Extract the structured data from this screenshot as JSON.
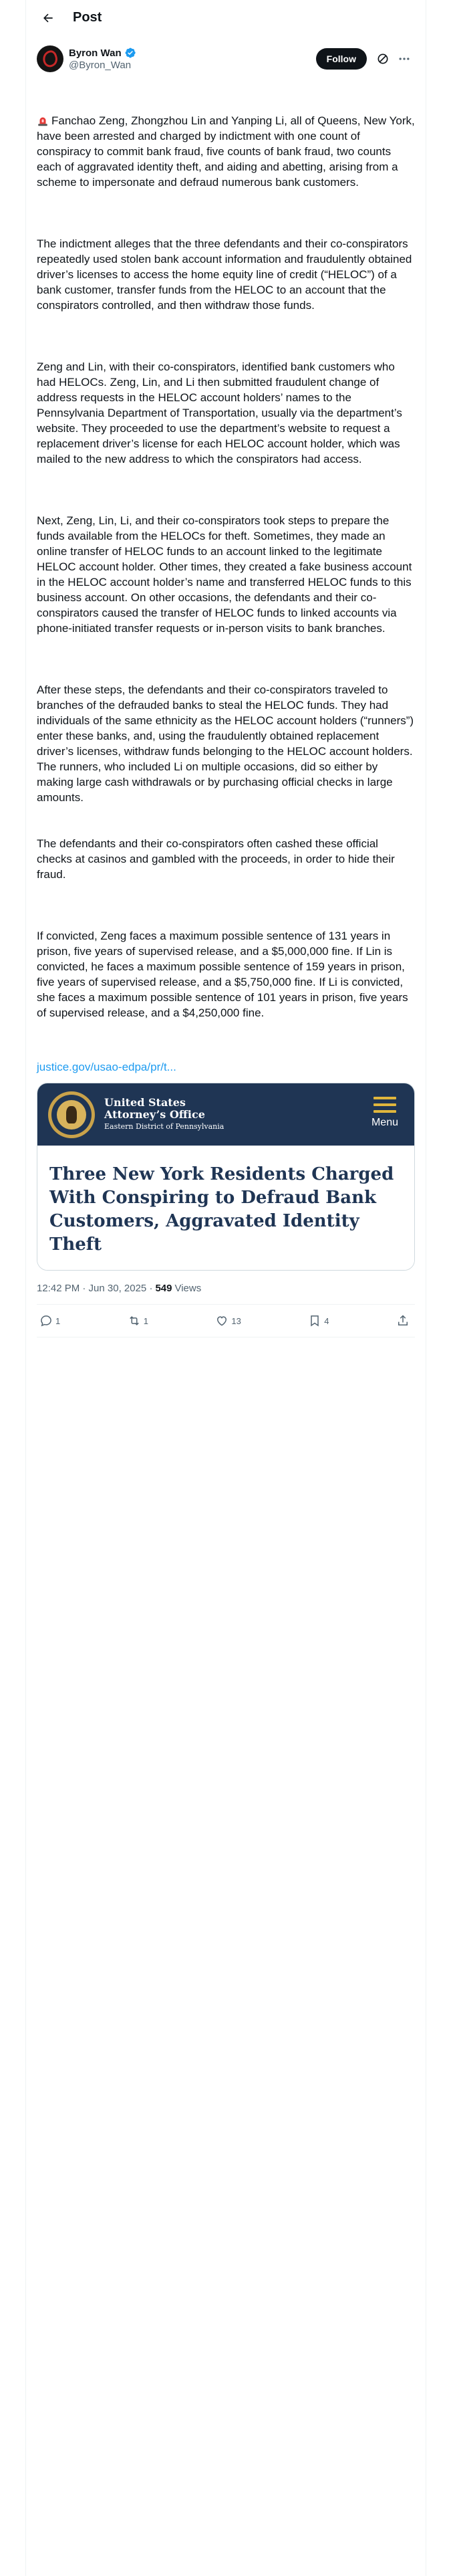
{
  "header": {
    "title": "Post"
  },
  "author": {
    "display_name": "Byron Wan",
    "handle": "@Byron_Wan",
    "verified": true
  },
  "follow_button": {
    "label": "Follow"
  },
  "tweet": {
    "paragraphs": [
      "Fanchao Zeng, Zhongzhou Lin and Yanping Li, all of Queens, New York, have been arrested and charged by indictment with one count of conspiracy to commit bank fraud, five counts of bank fraud, two counts each of aggravated identity theft, and aiding and abetting, arising from a scheme to impersonate and defraud numerous bank customers.",
      "The indictment alleges that the three defendants and their co-conspirators repeatedly used stolen bank account information and fraudulently obtained driver’s licenses to access the home equity line of credit (“HELOC”) of a bank customer, transfer funds from the HELOC to an account that the conspirators controlled, and then withdraw those funds.",
      "Zeng and Lin, with their co-conspirators, identified bank customers who had HELOCs. Zeng, Lin, and Li then submitted fraudulent change of address requests in the HELOC account holders’ names to the Pennsylvania Department of Transportation, usually via the department’s website. They proceeded to use the department’s website to request a replacement driver’s license for each HELOC account holder, which was mailed to the new address to which the conspirators had access.",
      "Next, Zeng, Lin, Li, and their co-conspirators took steps to prepare the funds available from the HELOCs for theft. Sometimes, they made an online transfer of HELOC funds to an account linked to the legitimate HELOC account holder. Other times, they created a fake business account in the HELOC account holder’s name and transferred HELOC funds to this business account. On other occasions, the defendants and their co-conspirators caused the transfer of HELOC funds to linked accounts via phone-initiated transfer requests or in-person visits to bank branches.",
      "After these steps, the defendants and their co-conspirators traveled to branches of the defrauded banks to steal the HELOC funds. They had individuals of the same ethnicity as the HELOC account holders (“runners”) enter these banks, and, using the fraudulently obtained replacement driver’s licenses, withdraw funds belonging to the HELOC account holders. The runners, who included Li on multiple occasions, did so either by making large cash withdrawals or by purchasing official checks in large amounts.",
      "The defendants and their co-conspirators often cashed these official checks at casinos and gambled with the proceeds, in order to hide their fraud.",
      "If convicted, Zeng faces a maximum possible sentence of 131 years in prison, five years of supervised release, and a $5,000,000 fine. If Lin is convicted, he faces a maximum possible sentence of 159 years in prison, five years of supervised release, and a $5,750,000 fine. If Li is convicted, she faces a maximum possible sentence of 101 years in prison, five years of supervised release, and a $4,250,000 fine."
    ],
    "link_text": "justice.gov/usao-edpa/pr/t..."
  },
  "card": {
    "office_line1": "United States",
    "office_line2": "Attorney’s Office",
    "office_line3": "Eastern District of Pennsylvania",
    "menu_label": "Menu",
    "headline": "Three New York Residents Charged With Conspiring to Defraud Bank Customers, Aggravated Identity Theft"
  },
  "meta": {
    "timestamp": "12:42 PM · Jun 30, 2025 · ",
    "views_count": "549",
    "views_label": "Views"
  },
  "actions": {
    "replies": "1",
    "reposts": "1",
    "likes": "13",
    "bookmarks": "4"
  },
  "colors": {
    "accent": "#1d9bf0",
    "text": "#0f1419",
    "muted": "#536471",
    "card_navy": "#1f3554",
    "card_gold": "#e0b63c"
  },
  "icons": [
    "back-arrow-icon",
    "verified-badge-icon",
    "grok-icon",
    "more-icon",
    "siren-icon",
    "seal-icon",
    "menu-icon",
    "reply-icon",
    "repost-icon",
    "like-icon",
    "bookmark-icon",
    "share-icon"
  ]
}
